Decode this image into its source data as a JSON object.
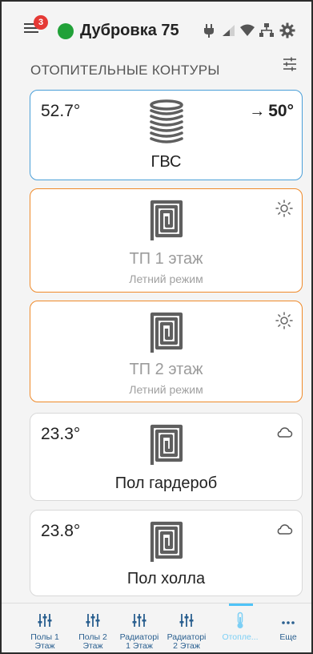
{
  "header": {
    "notification_count": "3",
    "device_name": "Дубровка 75",
    "status_color": "#21a138",
    "icons": [
      "menu-icon",
      "plug-icon",
      "signal-icon",
      "wifi-icon",
      "network-icon",
      "gear-icon"
    ]
  },
  "section": {
    "title": "ОТОПИТЕЛЬНЫЕ КОНТУРЫ"
  },
  "circuits": [
    {
      "temp": "52.7°",
      "target_arrow": "→",
      "target": "50°",
      "name": "ГВС",
      "mode": "",
      "icon": "coil-icon",
      "corner_icon": "",
      "border": "#4a9fd8"
    },
    {
      "temp": "",
      "name": "ТП 1 этаж",
      "mode": "Летний режим",
      "icon": "floor-heating-icon",
      "corner_icon": "sun-icon",
      "border": "#ef8a2a"
    },
    {
      "temp": "",
      "name": "ТП 2 этаж",
      "mode": "Летний режим",
      "icon": "floor-heating-icon",
      "corner_icon": "sun-icon",
      "border": "#ef8a2a"
    },
    {
      "temp": "23.3°",
      "name": "Пол гардероб",
      "mode": "",
      "icon": "floor-heating-icon",
      "corner_icon": "cloud-icon",
      "border": "#d8d8d8"
    },
    {
      "temp": "23.8°",
      "name": "Пол холла",
      "mode": "",
      "icon": "floor-heating-icon",
      "corner_icon": "cloud-icon",
      "border": "#d8d8d8"
    }
  ],
  "bottom_nav": [
    {
      "label": "Полы 1\nЭтаж",
      "icon": "sliders-icon",
      "active": false
    },
    {
      "label": "Полы 2\nЭтаж",
      "icon": "sliders-icon",
      "active": false
    },
    {
      "label": "Радиаторі\n1 Этаж",
      "icon": "sliders-icon",
      "active": false
    },
    {
      "label": "Радиаторі\n2 Этаж",
      "icon": "sliders-icon",
      "active": false
    },
    {
      "label": "Отопле...",
      "icon": "thermometer-icon",
      "active": true
    },
    {
      "label": "Еще",
      "icon": "more-icon",
      "active": false
    }
  ],
  "colors": {
    "accent": "#4fc3f7",
    "nav_text": "#2a5f8f",
    "badge": "#e53935"
  }
}
